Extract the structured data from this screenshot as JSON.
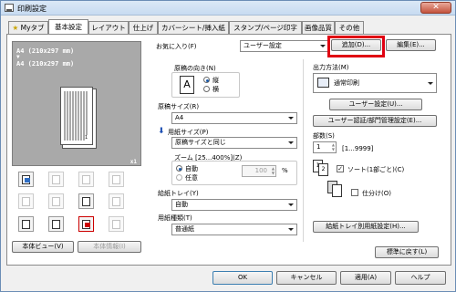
{
  "window": {
    "title": "印刷設定",
    "close_label": "✕"
  },
  "tabs": [
    {
      "label": "Myタブ"
    },
    {
      "label": "基本設定"
    },
    {
      "label": "レイアウト"
    },
    {
      "label": "仕上げ"
    },
    {
      "label": "カバーシート/挿入紙"
    },
    {
      "label": "スタンプ/ページ印字"
    },
    {
      "label": "画像品質"
    },
    {
      "label": "その他"
    }
  ],
  "preview": {
    "line1": "A4 (210x297 mm)",
    "arrow": "▼",
    "line2": "A4 (210x297 mm)",
    "scale": "x1",
    "page_number": "1"
  },
  "left_buttons": {
    "view": "本体ビュー(V)",
    "info": "本体情報(I)"
  },
  "favorites": {
    "label": "お気に入り(F)",
    "value": "ユーザー設定",
    "add": "追加(D)...",
    "edit": "編集(E)..."
  },
  "orientation": {
    "label": "原稿の向き(N)",
    "portrait": "縦",
    "landscape": "横"
  },
  "original_size": {
    "label": "原稿サイズ(R)",
    "value": "A4"
  },
  "paper_size": {
    "label": "用紙サイズ(P)",
    "value": "原稿サイズと同じ"
  },
  "zoom": {
    "label": "ズーム [25...400%](Z)",
    "auto": "自動",
    "manual": "任意",
    "value": "100",
    "unit": "%"
  },
  "paper_tray": {
    "label": "給紙トレイ(Y)",
    "value": "自動"
  },
  "paper_type": {
    "label": "用紙種類(T)",
    "value": "普通紙"
  },
  "output": {
    "label": "出力方法(M)",
    "value": "通常印刷",
    "user_settings": "ユーザー設定(U)...",
    "auth_settings": "ユーザー認証/部門管理設定(E)..."
  },
  "copies": {
    "label": "部数(S)",
    "value": "1",
    "range": "[1...9999]",
    "collate": "ソート(1部ごと)(C)",
    "offset": "仕分け(O)"
  },
  "tray_settings": "給紙トレイ別用紙設定(H)...",
  "restore_defaults": "標準に戻す(L)",
  "footer": {
    "ok": "OK",
    "cancel": "キャンセル",
    "apply": "適用(A)",
    "help": "ヘルプ"
  }
}
